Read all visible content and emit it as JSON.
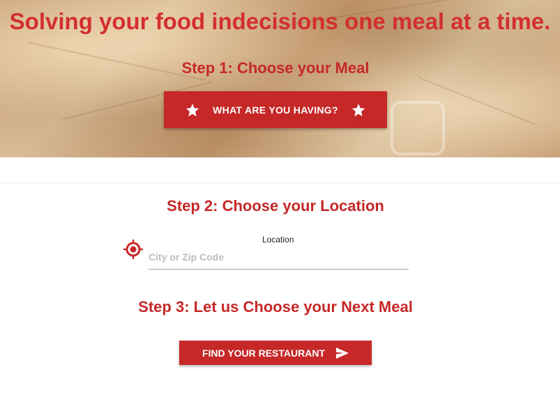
{
  "hero": {
    "title": "Solving your food indecisions one meal at a time.",
    "step1_heading": "Step 1: Choose your Meal",
    "meal_button_label": "WHAT ARE YOU HAVING?"
  },
  "location": {
    "step2_heading": "Step 2: Choose your Location",
    "label": "Location",
    "placeholder": "City or Zip Code",
    "value": "",
    "icon": "target-location-icon"
  },
  "restaurant": {
    "step3_heading": "Step 3: Let us Choose your Next Meal",
    "find_button_label": "FIND YOUR RESTAURANT",
    "icon": "send-icon"
  },
  "colors": {
    "accent": "#c62828",
    "title_red": "#d32f2f",
    "button_text": "#ffffff"
  }
}
